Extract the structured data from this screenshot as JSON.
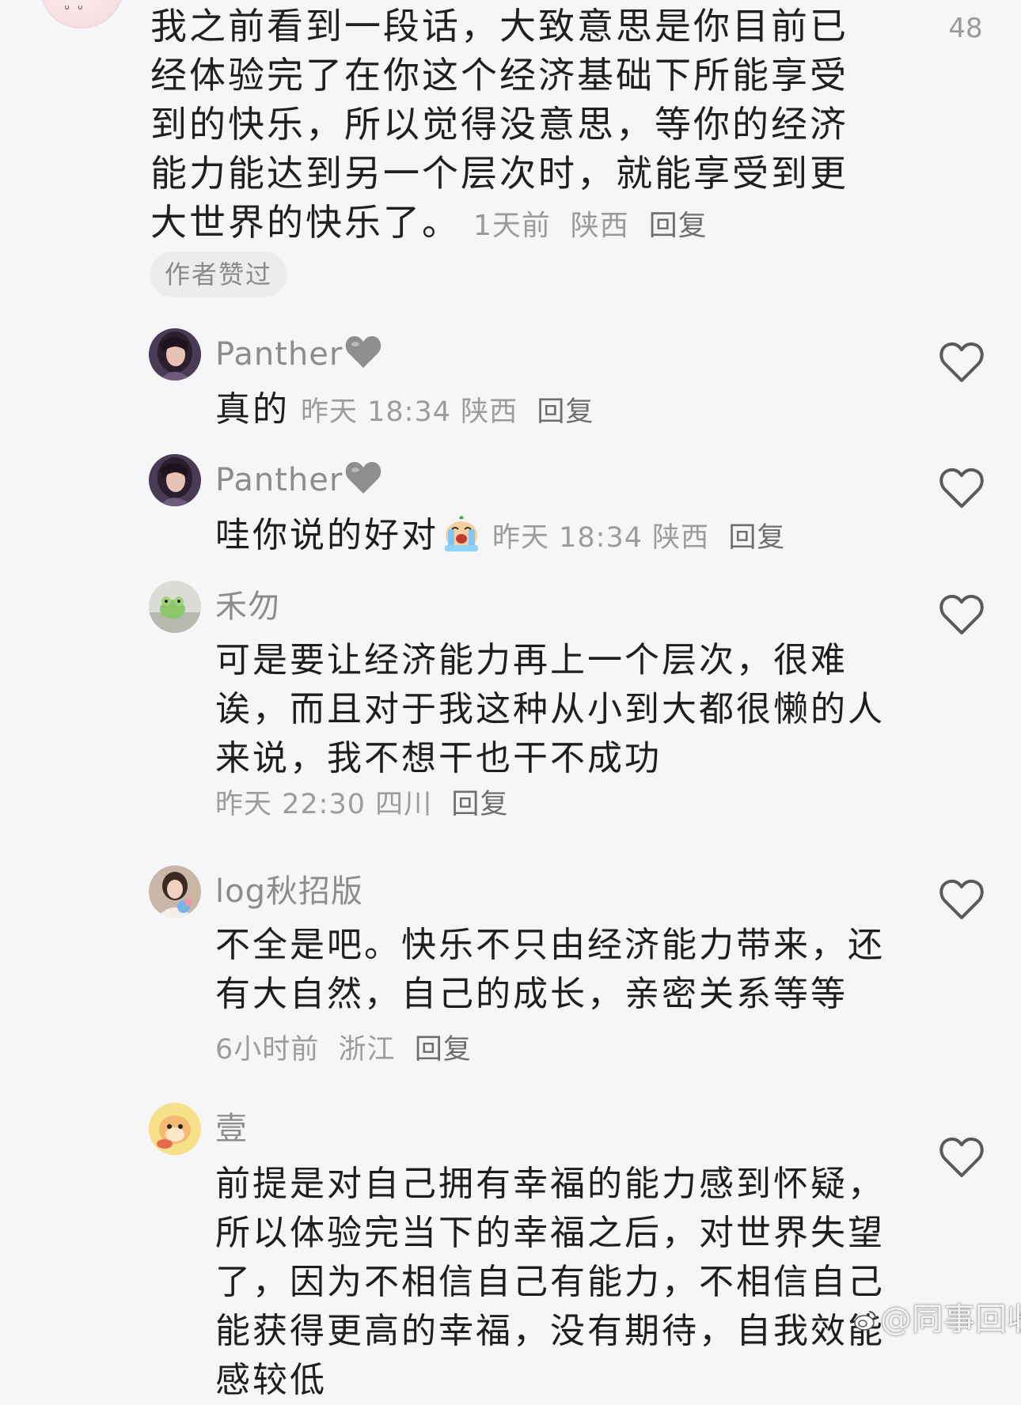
{
  "top_comment": {
    "text": "我之前看到一段话，大致意思是你目前已经体验完了在你这个经济基础下所能享受到的快乐，所以觉得没意思，等你的经济能力能达到另一个层次时，就能享受到更大世界的快乐了。",
    "time": "1天前",
    "location": "陕西",
    "reply_label": "回复",
    "like_count": "48",
    "author_liked_badge": "作者赞过"
  },
  "replies": [
    {
      "username": "Panther",
      "text": "真的",
      "time": "昨天 18:34",
      "location": "陕西",
      "reply_label": "回复",
      "avatar_icon": "portrait-avatar",
      "username_icon": "grey-heart-icon"
    },
    {
      "username": "Panther",
      "text": "哇你说的好对",
      "emoji_icon": "crying-emoji-icon",
      "time": "昨天 18:34",
      "location": "陕西",
      "reply_label": "回复",
      "avatar_icon": "portrait-avatar",
      "username_icon": "grey-heart-icon"
    },
    {
      "username": "禾勿",
      "text": "可是要让经济能力再上一个层次，很难诶，而且对于我这种从小到大都很懒的人来说，我不想干也干不成功",
      "time": "昨天 22:30",
      "location": "四川",
      "reply_label": "回复",
      "avatar_icon": "frog-avatar"
    },
    {
      "username": "log秋招版",
      "text": "不全是吧。快乐不只由经济能力带来，还有大自然，自己的成长，亲密关系等等",
      "time": "6小时前",
      "location": "浙江",
      "reply_label": "回复",
      "avatar_icon": "girl-avatar"
    },
    {
      "username": "壹",
      "text": "前提是对自己拥有幸福的能力感到怀疑，所以体验完当下的幸福之后，对世界失望了，因为不相信自己有能力，不相信自己能获得更高的幸福，没有期待，自我效能感较低",
      "avatar_icon": "cartoon-avatar"
    }
  ],
  "watermark": {
    "text": "@同事回收站",
    "icon": "weibo-icon"
  },
  "colors": {
    "background": "#f6f6f8",
    "text": "#1e1e1e",
    "meta": "#9c9c9c",
    "reply": "#6e6e6e",
    "badge_bg": "#ececef"
  }
}
